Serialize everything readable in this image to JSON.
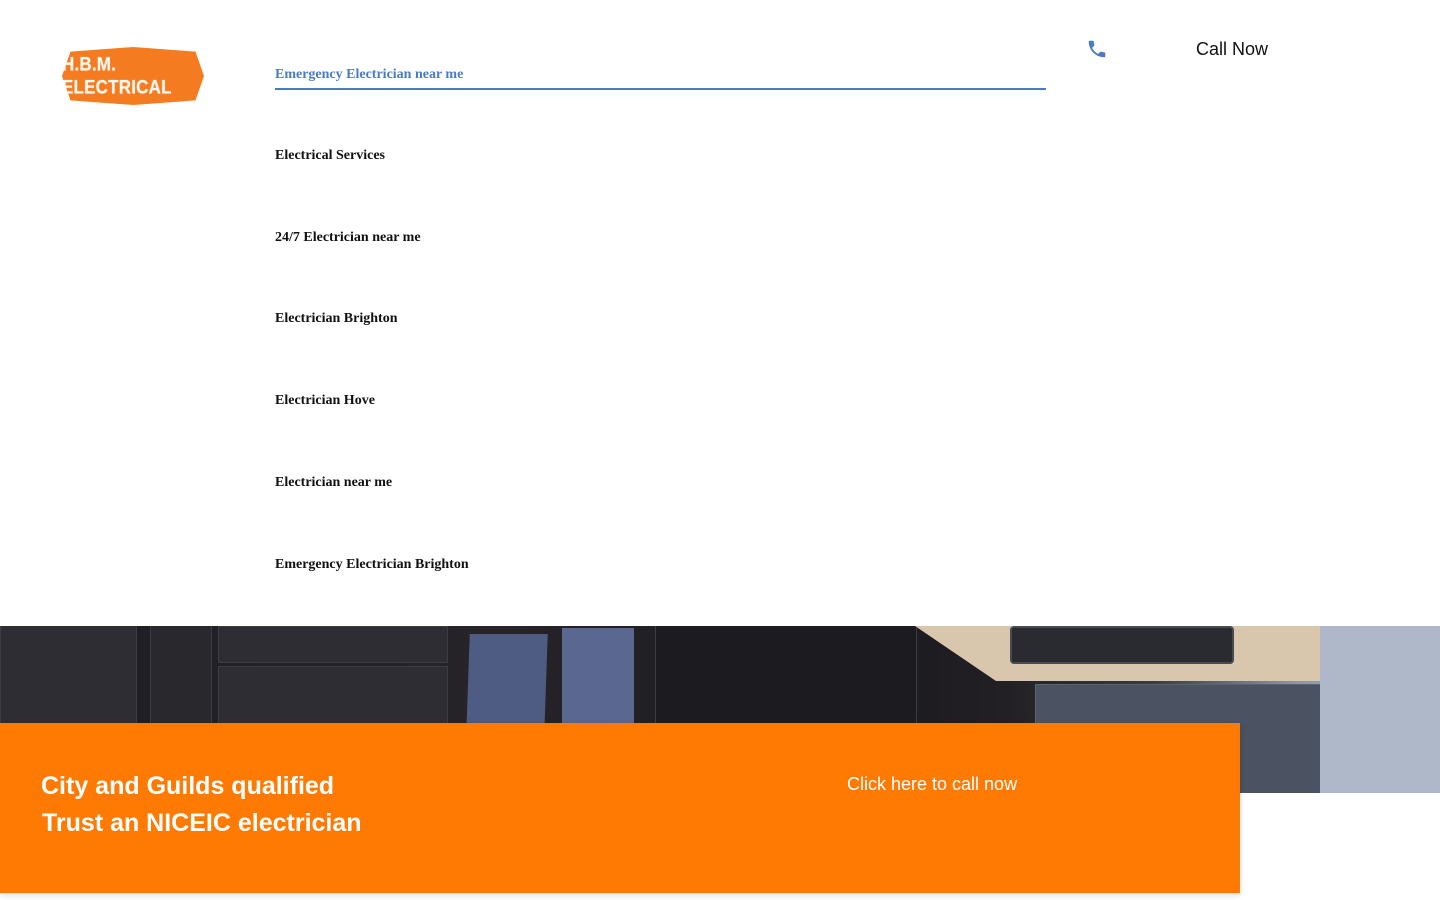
{
  "header": {
    "logo_text": "H.B.M. ELECTRICAL",
    "nav_items": [
      {
        "label": "Emergency Electrician near me",
        "active": true
      },
      {
        "label": "Electrical Services"
      },
      {
        "label": "24/7 Electrician near me"
      },
      {
        "label": "Electrician Brighton"
      },
      {
        "label": "Electrician Hove"
      },
      {
        "label": "Electrician near me"
      },
      {
        "label": "Emergency Electrician Brighton"
      }
    ],
    "phone_icon": "phone-icon",
    "call_now_label": "Call Now"
  },
  "banner": {
    "line1": "City and Guilds qualified",
    "line2": "Trust an NICEIC electrician",
    "cta_label": "Click here to call now"
  },
  "colors": {
    "accent_orange": "#ff7a03",
    "link_blue": "#4a7cc0",
    "text_dark": "#111111"
  }
}
